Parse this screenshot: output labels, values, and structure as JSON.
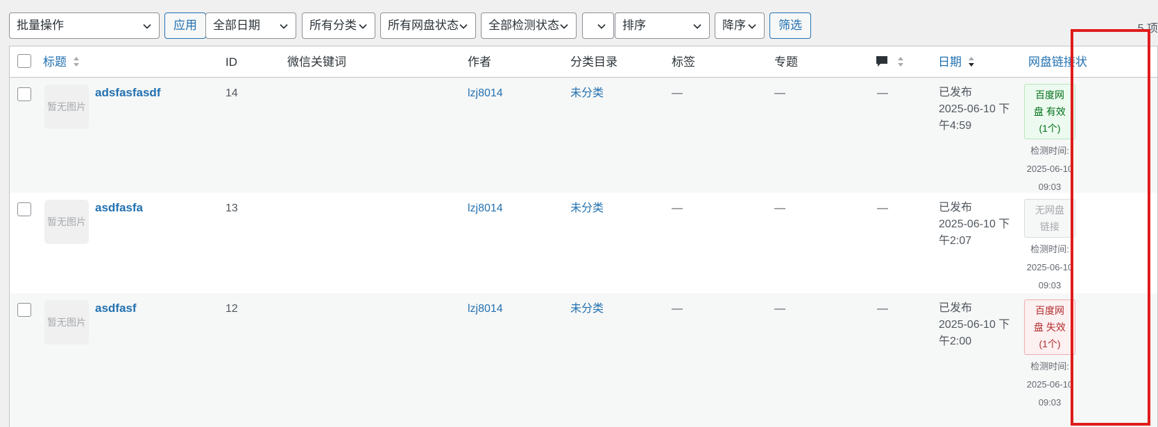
{
  "toolbar": {
    "bulk_action": "批量操作",
    "apply": "应用",
    "date_filter": "全部日期",
    "category_filter": "所有分类",
    "netdisk_status_filter": "所有网盘状态",
    "check_status_filter": "全部检测状态",
    "blank_filter": "",
    "sort_by": "排序",
    "sort_order": "降序",
    "filter_button": "筛选",
    "item_count": "5 项"
  },
  "columns": {
    "title": "标题",
    "id": "ID",
    "wechat_keyword": "微信关键词",
    "author": "作者",
    "category": "分类目录",
    "tags": "标签",
    "topic": "专题",
    "date": "日期",
    "netdisk_status": "网盘链接状"
  },
  "rows": [
    {
      "thumb": "暂无图片",
      "title": "adsfasfasdf",
      "id": "14",
      "author": "lzj8014",
      "category": "未分类",
      "tags": "—",
      "topic": "—",
      "comments": "—",
      "date_status": "已发布",
      "date_line1": "2025-06-10 下",
      "date_line2": "午4:59",
      "badge_line1": "百度网",
      "badge_line2": "盘 有效",
      "badge_line3": "(1个)",
      "check_label": "检测时间:",
      "check_date": "2025-06-10",
      "check_time": "09:03"
    },
    {
      "thumb": "暂无图片",
      "title": "asdfasfa",
      "id": "13",
      "author": "lzj8014",
      "category": "未分类",
      "tags": "—",
      "topic": "—",
      "comments": "—",
      "date_status": "已发布",
      "date_line1": "2025-06-10 下",
      "date_line2": "午2:07",
      "badge_line1": "无网盘",
      "badge_line2": "链接",
      "badge_line3": "",
      "check_label": "检测时间:",
      "check_date": "2025-06-10",
      "check_time": "09:03"
    },
    {
      "thumb": "暂无图片",
      "title": "asdfasf",
      "id": "12",
      "author": "lzj8014",
      "category": "未分类",
      "tags": "—",
      "topic": "—",
      "comments": "—",
      "date_status": "已发布",
      "date_line1": "2025-06-10 下",
      "date_line2": "午2:00",
      "badge_line1": "百度网",
      "badge_line2": "盘 失效",
      "badge_line3": "(1个)",
      "check_label": "检测时间:",
      "check_date": "2025-06-10",
      "check_time": "09:03"
    }
  ],
  "colors": {
    "link": "#2271b1",
    "highlight_border": "#e01b1b",
    "valid": "#00701a",
    "invalid": "#b32d2e"
  }
}
